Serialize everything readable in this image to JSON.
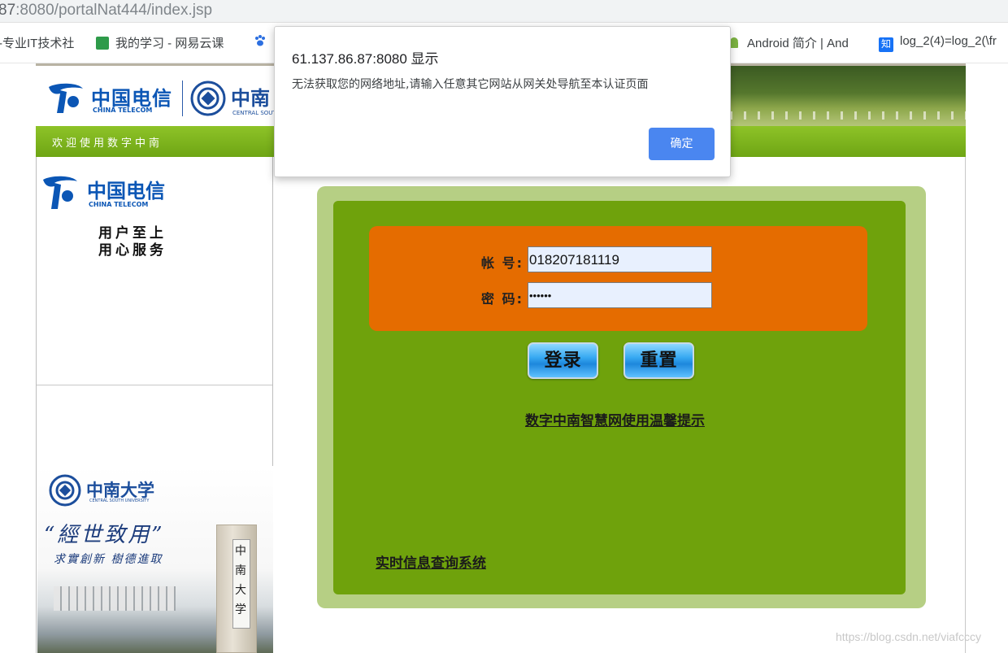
{
  "browser": {
    "url_prefix": "87",
    "url_rest": ":8080/portalNat444/index.jsp",
    "bookmarks": [
      {
        "label": "-专业IT技术社",
        "icon": "site-icon"
      },
      {
        "label": "我的学习 - 网易云课",
        "icon": "book-icon"
      },
      {
        "label": "",
        "icon": "baidu-paw-icon"
      },
      {
        "label": "Android 简介 |  And",
        "icon": "android-icon"
      },
      {
        "label": "log_2(4)=log_2(\\fr",
        "icon": "zhihu-icon",
        "icon_text": "知"
      }
    ],
    "colors": {
      "zhihu": "#1772f6",
      "android": "#7cb342",
      "book": "#2e9b4a",
      "baidu": "#2c6fe0"
    }
  },
  "header": {
    "telecom_logo": {
      "cn": "中国电信",
      "en": "CHINA TELECOM"
    },
    "csu_logo": {
      "cn": "中南",
      "en": "CENTRAL SOUT"
    },
    "welcome": "欢迎使用数字中南"
  },
  "sidebar": {
    "telecom_logo": {
      "cn": "中国电信",
      "en": "CHINA TELECOM"
    },
    "slogan_line1": "用户至上",
    "slogan_line2": "用心服务",
    "csu_logo": {
      "cn": "中南大学",
      "en": "CENTRAL SOUTH UNIVERSITY"
    },
    "motto_main": "“經世致用”",
    "motto_sub": "求實創新  樹德進取",
    "gate_chars": [
      "中",
      "南",
      "大",
      "学"
    ]
  },
  "login": {
    "account_label": "帐 号:",
    "account_value": "018207181119",
    "password_label": "密 码:",
    "password_value": "••••••",
    "login_button": "登录",
    "reset_button": "重置",
    "tips_link": "数字中南智慧网使用温馨提示",
    "query_link": "实时信息查询系统",
    "colors": {
      "panel_outer": "#b6cf84",
      "panel_inner": "#6fa20c",
      "form_box": "#e56c00",
      "field_bg": "#e8f0fe"
    }
  },
  "dialog": {
    "title": "61.137.86.87:8080 显示",
    "message": "无法获取您的网络地址,请输入任意其它网站从网关处导航至本认证页面",
    "ok_button": "确定",
    "button_color": "#4a86f0"
  },
  "watermark": "https://blog.csdn.net/viafcccy"
}
